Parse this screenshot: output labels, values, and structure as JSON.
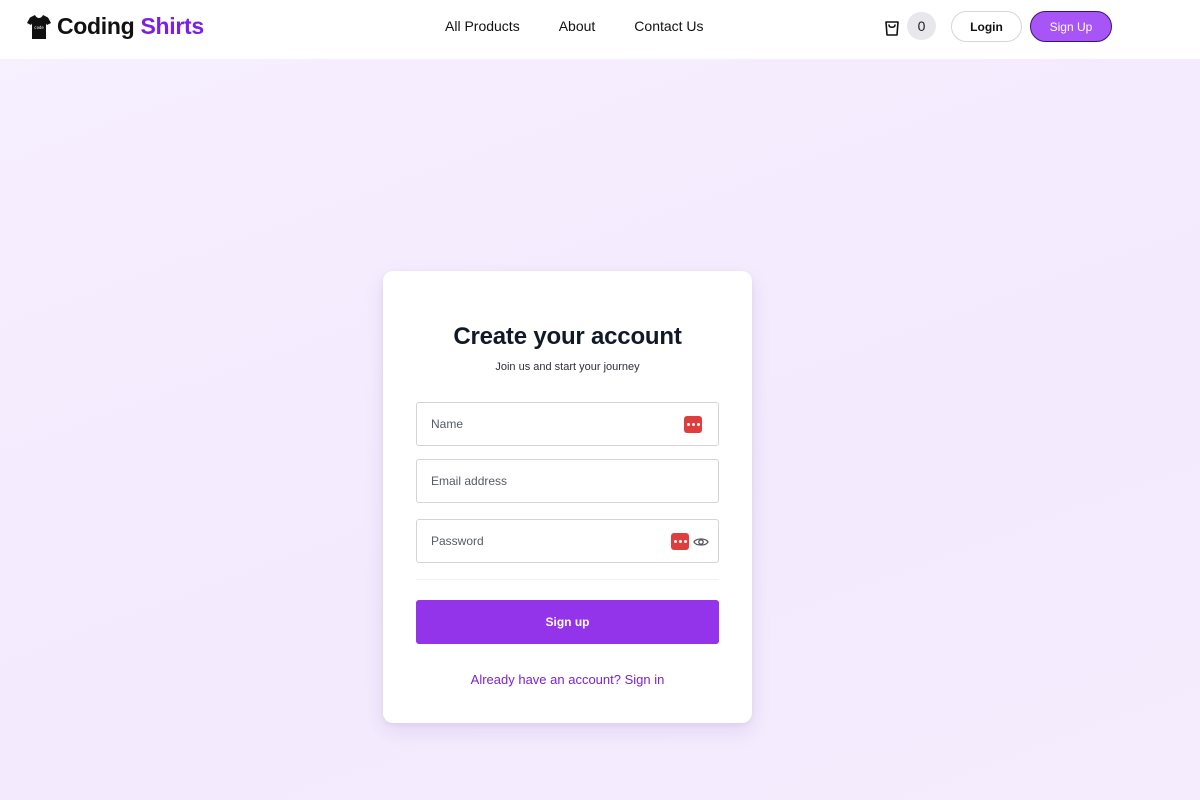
{
  "header": {
    "logo_primary": "Coding",
    "logo_accent": "Shirts",
    "nav": [
      {
        "label": "All Products"
      },
      {
        "label": "About"
      },
      {
        "label": "Contact Us"
      }
    ],
    "cart_count": "0",
    "login_label": "Login",
    "signup_label": "Sign Up"
  },
  "card": {
    "title": "Create your account",
    "subtitle": "Join us and start your journey",
    "fields": {
      "name_placeholder": "Name",
      "email_placeholder": "Email address",
      "password_placeholder": "Password"
    },
    "submit_label": "Sign up",
    "signin_link": "Already have an account? Sign in"
  },
  "colors": {
    "accent": "#9333ea",
    "logo_accent": "#7c1fe6",
    "header_signup": "#a855f7",
    "password_manager_icon": "#e03e3e"
  },
  "icons": {
    "logo": "tshirt-icon",
    "cart": "shopping-bag-icon",
    "password_manager": "password-manager-icon",
    "reveal": "eye-icon"
  }
}
